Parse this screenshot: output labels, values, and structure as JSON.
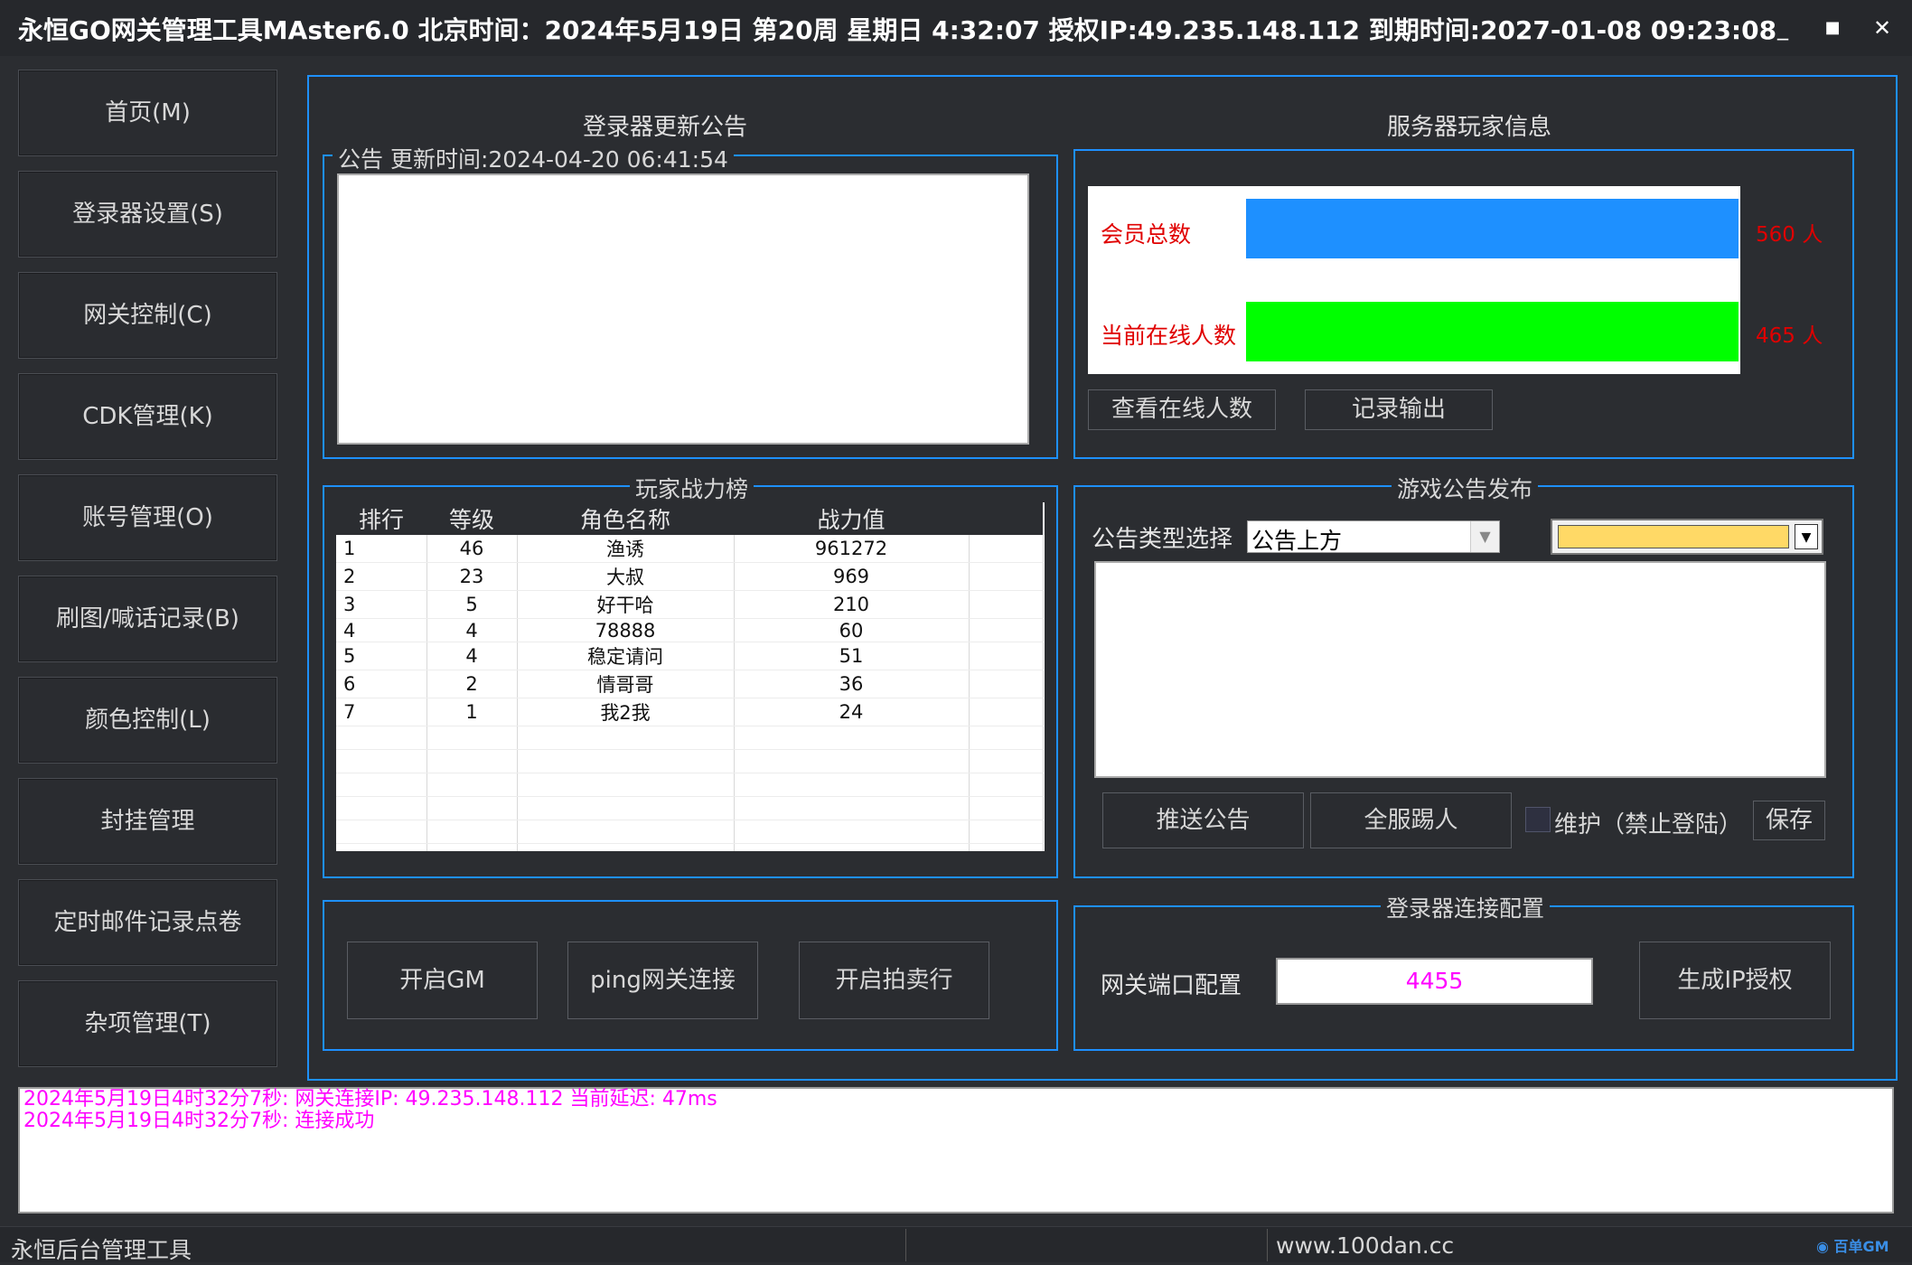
{
  "window": {
    "title": "永恒GO网关管理工具MAster6.0 北京时间：2024年5月19日 第20周 星期日 4:32:07   授权IP:49.235.148.112   到期时间:2027-01-08 09:23:08",
    "minimize": "_",
    "maximize": "■",
    "close": "✕"
  },
  "sidebar": {
    "items": [
      {
        "label": "首页(M)"
      },
      {
        "label": "登录器设置(S)"
      },
      {
        "label": "网关控制(C)"
      },
      {
        "label": "CDK管理(K)"
      },
      {
        "label": "账号管理(O)"
      },
      {
        "label": "刷图/喊话记录(B)"
      },
      {
        "label": "颜色控制(L)"
      },
      {
        "label": "封挂管理"
      },
      {
        "label": "定时邮件记录点卷"
      },
      {
        "label": "杂项管理(T)"
      }
    ]
  },
  "announcement": {
    "heading": "登录器更新公告",
    "legend": "公告 更新时间:2024-04-20 06:41:54"
  },
  "server_info": {
    "heading": "服务器玩家信息",
    "total_label": "会员总数",
    "total_value": "560 人",
    "total_fraction": 1.0,
    "online_label": "当前在线人数",
    "online_value": "465 人",
    "online_fraction": 1.0,
    "total_color": "#1e90ff",
    "online_color": "#00ff00",
    "view_online_button": "查看在线人数",
    "export_button": "记录输出"
  },
  "ranking": {
    "legend": "玩家战力榜",
    "columns": [
      "排行",
      "等级",
      "角色名称",
      "战力值"
    ],
    "rows": [
      [
        "1",
        "46",
        "渔诱",
        "961272"
      ],
      [
        "2",
        "23",
        "大叔",
        "969"
      ],
      [
        "3",
        "5",
        "好干哈",
        "210"
      ],
      [
        "4",
        "4",
        "78888",
        "60"
      ],
      [
        "5",
        "4",
        "稳定请问",
        "51"
      ],
      [
        "6",
        "2",
        "情哥哥",
        "36"
      ],
      [
        "7",
        "1",
        "我2我",
        "24"
      ]
    ],
    "empty_rows": 6
  },
  "game_notice": {
    "legend": "游戏公告发布",
    "type_label": "公告类型选择",
    "type_value": "公告上方",
    "color_value": "#ffd966",
    "push_button": "推送公告",
    "kick_button": "全服踢人",
    "maintenance_label": "维护（禁止登陆）",
    "save_button": "保存"
  },
  "gm_actions": {
    "open_gm": "开启GM",
    "ping": "ping网关连接",
    "auction": "开启拍卖行"
  },
  "connection": {
    "legend": "登录器连接配置",
    "port_label": "网关端口配置",
    "port_value": "4455",
    "generate_button": "生成IP授权"
  },
  "log": {
    "lines": [
      "2024年5月19日4时32分7秒: 网关连接IP: 49.235.148.112 当前延迟: 47ms",
      "2024年5月19日4时32分7秒: 连接成功"
    ]
  },
  "statusbar": {
    "left": "永恒后台管理工具",
    "website": "www.100dan.cc",
    "watermark": "百单GM"
  }
}
